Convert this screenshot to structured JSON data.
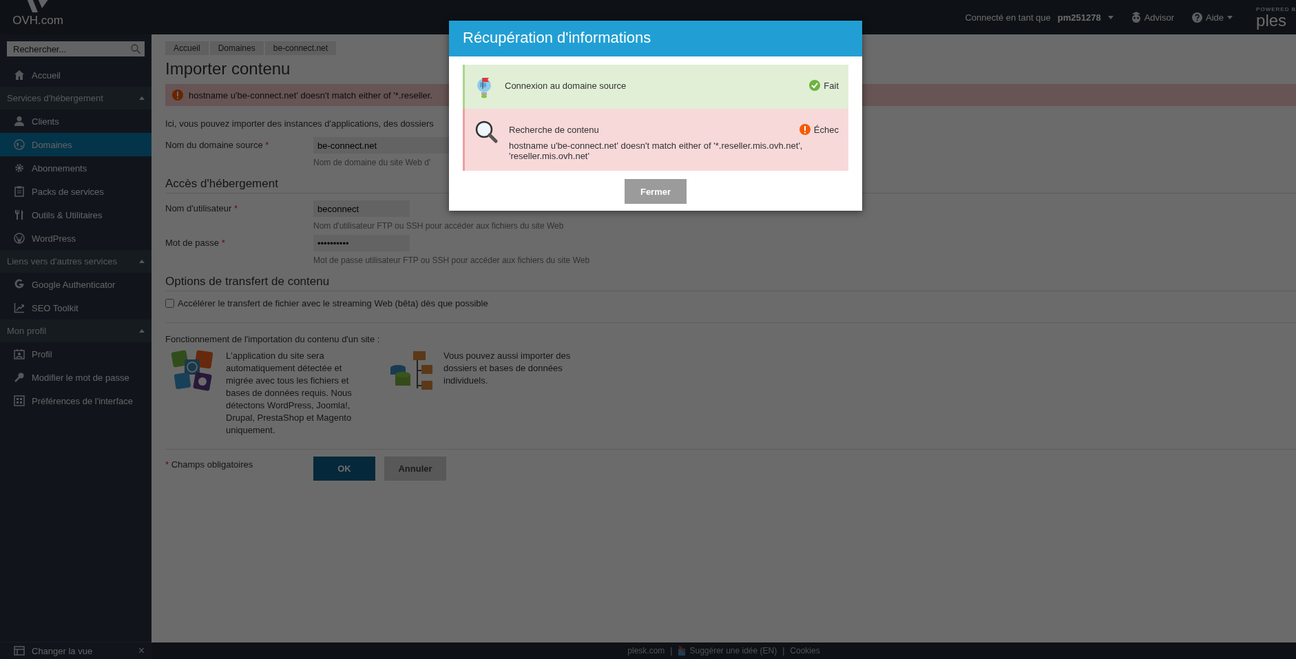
{
  "topbar": {
    "logo": "OVH.com",
    "user_label": "Connecté en tant que",
    "user": "pm251278",
    "advisor": "Advisor",
    "help": "Aide",
    "powered_by": "POWERED B",
    "brand": "ples"
  },
  "sidebar": {
    "search": {
      "placeholder": "Rechercher..."
    },
    "items": [
      {
        "kind": "item",
        "label": "Accueil",
        "selected": false
      },
      {
        "kind": "section",
        "label": "Services d'hébergement",
        "expanded": true
      },
      {
        "kind": "item",
        "label": "Clients",
        "selected": false
      },
      {
        "kind": "item",
        "label": "Domaines",
        "selected": true
      },
      {
        "kind": "item",
        "label": "Abonnements",
        "selected": false
      },
      {
        "kind": "item",
        "label": "Packs de services",
        "selected": false
      },
      {
        "kind": "item",
        "label": "Outils & Utilitaires",
        "selected": false
      },
      {
        "kind": "item",
        "label": "WordPress",
        "selected": false
      },
      {
        "kind": "section",
        "label": "Liens vers d'autres services",
        "expanded": true
      },
      {
        "kind": "item",
        "label": "Google Authenticator",
        "selected": false
      },
      {
        "kind": "item",
        "label": "SEO Toolkit",
        "selected": false
      },
      {
        "kind": "section",
        "label": "Mon profil",
        "expanded": true
      },
      {
        "kind": "item",
        "label": "Profil",
        "selected": false
      },
      {
        "kind": "item",
        "label": "Modifier le mot de passe",
        "selected": false
      },
      {
        "kind": "item",
        "label": "Préférences de l'interface",
        "selected": false
      }
    ],
    "bottom": {
      "label": "Changer la vue",
      "close": "×"
    }
  },
  "breadcrumbs": [
    "Accueil",
    "Domaines",
    "be-connect.net"
  ],
  "page_title": "Importer contenu",
  "error": "hostname u'be-connect.net' doesn't match either of '*.reseller.",
  "intro": "Ici, vous pouvez importer des instances d'applications, des dossiers",
  "form": {
    "domain": {
      "label": "Nom du domaine source",
      "required": true,
      "value": "be-connect.net",
      "hint": "Nom de domaine du site Web d'"
    },
    "access_title": "Accès d'hébergement",
    "username": {
      "label": "Nom d'utilisateur",
      "required": true,
      "value": "beconnect",
      "hint": "Nom d'utilisateur FTP ou SSH pour accéder aux fichiers du site Web"
    },
    "password": {
      "label": "Mot de passe",
      "required": true,
      "value": "••••••••••",
      "hint": "Mot de passe utilisateur FTP ou SSH pour accéder aux fichiers du site Web"
    },
    "options_title": "Options de transfert de contenu",
    "streaming": {
      "label": "Accélérer le transfert de fichier avec le streaming Web (bêta) dès que possible",
      "checked": false
    },
    "how_title": "Fonctionnement de l'importation du contenu d'un site :",
    "how": [
      {
        "kind": "apps",
        "text": "L'application du site sera automatiquement détectée et migrée avec tous les fichiers et bases de données requis. Nous détectons WordPress, Joomla!, Drupal, PrestaShop et Magento uniquement."
      },
      {
        "kind": "data",
        "text": "Vous pouvez aussi importer des dossiers et bases de données individuels."
      }
    ],
    "required_mark": "*",
    "required_note": "Champs obligatoires",
    "ok": "OK",
    "cancel": "Annuler"
  },
  "footer": [
    {
      "kind": "link",
      "text": "plesk.com"
    },
    {
      "kind": "separator",
      "text": "|"
    },
    {
      "kind": "idea",
      "text": "Suggérer une idée (EN)"
    },
    {
      "kind": "separator",
      "text": "|"
    },
    {
      "kind": "link",
      "text": "Cookies"
    }
  ],
  "modal": {
    "title": "Récupération d'informations",
    "steps": [
      {
        "kind": "done",
        "title": "Connexion au domaine source",
        "status_label": "Fait"
      },
      {
        "kind": "failed",
        "title": "Recherche de contenu",
        "status_label": "Échec",
        "message": "hostname u'be-connect.net' doesn't match either of '*.reseller.mis.ovh.net', 'reseller.mis.ovh.net'"
      }
    ],
    "close": "Fermer"
  }
}
